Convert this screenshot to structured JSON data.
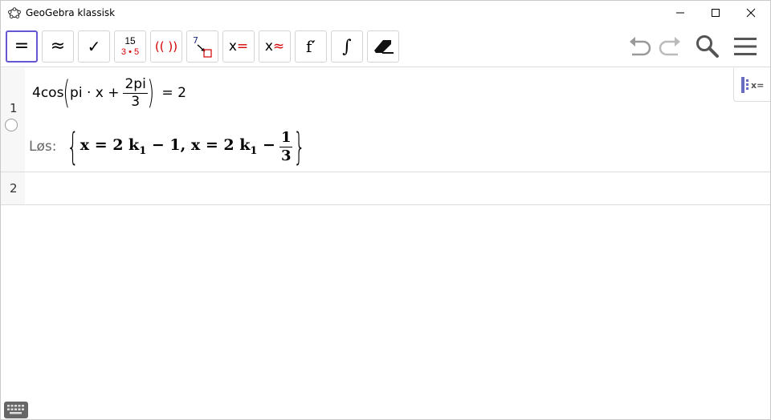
{
  "window": {
    "title": "GeoGebra klassisk"
  },
  "toolbar": {
    "tools": [
      {
        "id": "evaluate",
        "label": "="
      },
      {
        "id": "numeric",
        "label": "≈"
      },
      {
        "id": "keep-input",
        "label": "✓"
      },
      {
        "id": "factor-top",
        "label": "15"
      },
      {
        "id": "factor-bottom",
        "label": "3 • 5"
      },
      {
        "id": "expand",
        "label": "(( ))"
      },
      {
        "id": "substitute-top",
        "label": "7"
      },
      {
        "id": "solve",
        "label": "x="
      },
      {
        "id": "solve-numeric",
        "label": "x≈"
      },
      {
        "id": "derivative",
        "label": "f′"
      },
      {
        "id": "integral",
        "label": "∫"
      }
    ]
  },
  "rows": [
    {
      "number": "1",
      "input": {
        "prefix": "4cos",
        "inner": "pi · x +",
        "frac_num": "2pi",
        "frac_den": "3",
        "rhs": "=  2"
      },
      "output": {
        "label": "Løs:",
        "part1": "x = 2 k",
        "sub1": "1",
        "part2": " − 1, x = 2 k",
        "sub2": "1",
        "part3": " −",
        "frac_num": "1",
        "frac_den": "3"
      }
    },
    {
      "number": "2"
    }
  ],
  "colors": {
    "accent": "#6557d2",
    "red": "#d40000",
    "blue": "#1a237e",
    "gray_text": "#666666"
  }
}
